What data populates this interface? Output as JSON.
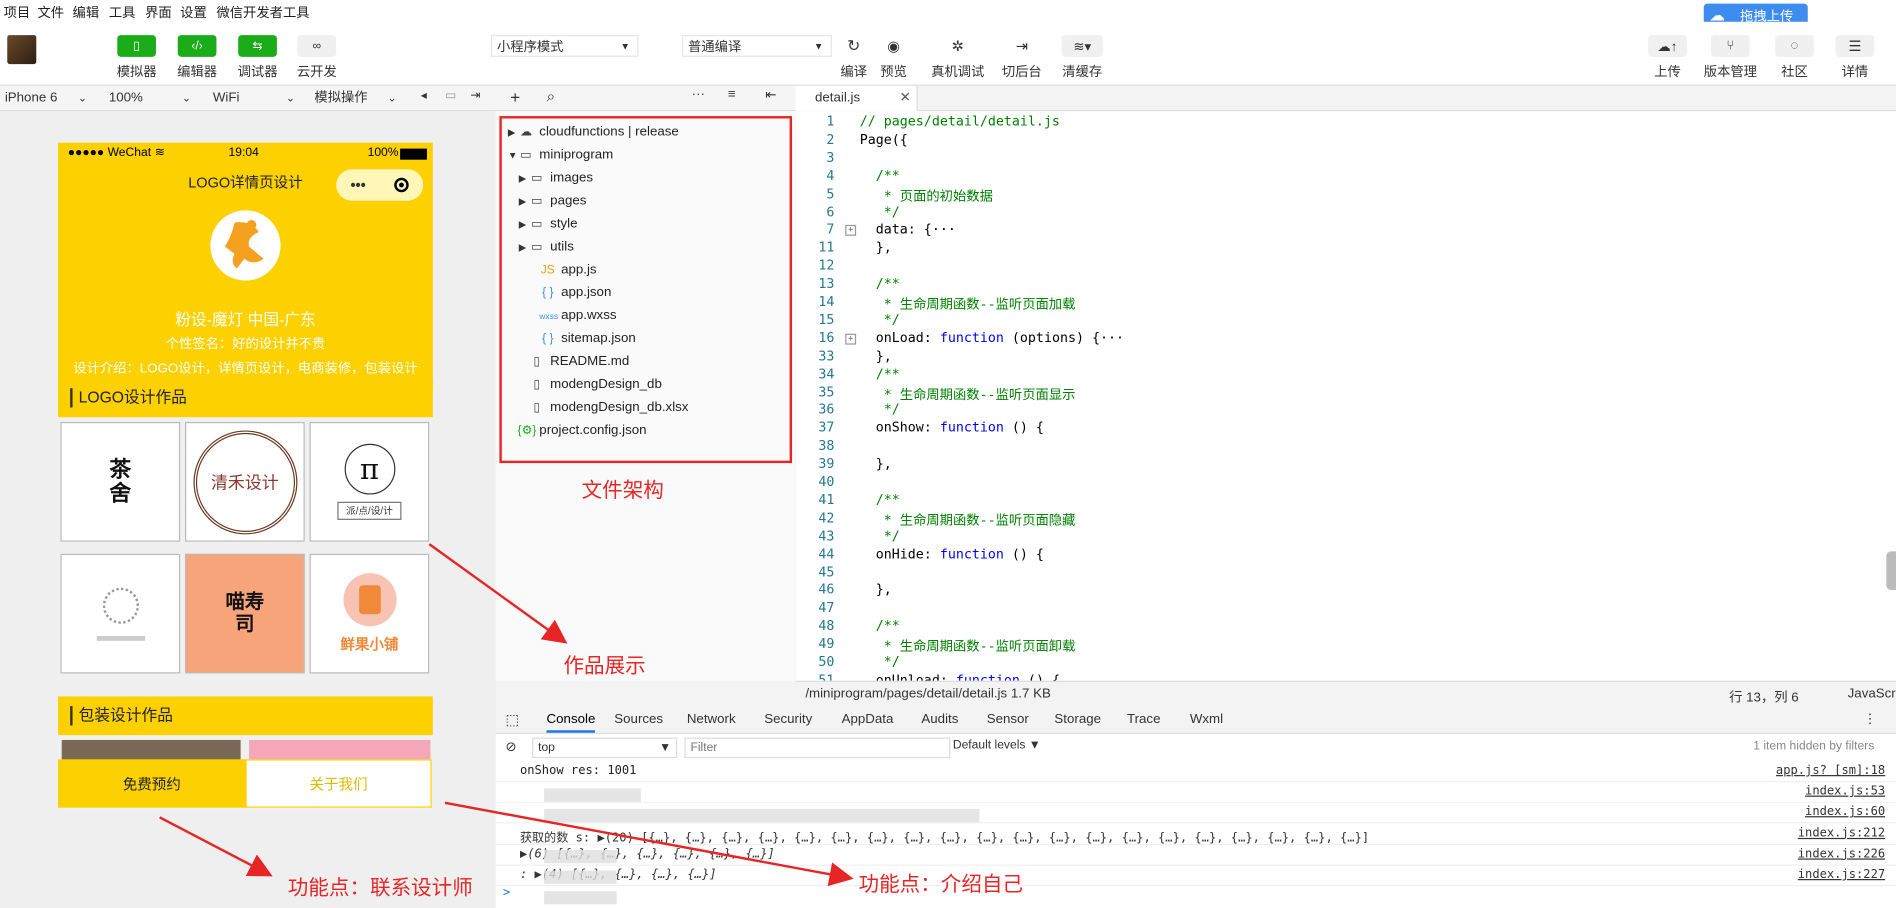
{
  "menubar": {
    "items": [
      "项目",
      "文件",
      "编辑",
      "工具",
      "界面",
      "设置",
      "微信开发者工具"
    ],
    "upload_badge": "拖拽上传"
  },
  "toolbar": {
    "left_buttons": [
      {
        "label": "模拟器",
        "icon": "phone-icon"
      },
      {
        "label": "编辑器",
        "icon": "code-icon"
      },
      {
        "label": "调试器",
        "icon": "debug-icon"
      },
      {
        "label": "云开发",
        "icon": "cloud-link-icon"
      }
    ],
    "mode_select": "小程序模式",
    "compile_select": "普通编译",
    "mid_buttons": [
      {
        "label": "编译",
        "icon": "refresh-icon"
      },
      {
        "label": "预览",
        "icon": "eye-icon"
      },
      {
        "label": "真机调试",
        "icon": "bug-icon"
      },
      {
        "label": "切后台",
        "icon": "switch-icon"
      },
      {
        "label": "清缓存",
        "icon": "layers-icon"
      }
    ],
    "right_buttons": [
      {
        "label": "上传",
        "icon": "upload-icon"
      },
      {
        "label": "版本管理",
        "icon": "branch-icon"
      },
      {
        "label": "社区",
        "icon": "chat-icon"
      },
      {
        "label": "详情",
        "icon": "menu-icon"
      }
    ]
  },
  "devicebar": {
    "device": "iPhone 6",
    "zoom": "100%",
    "network": "WiFi",
    "operation": "模拟操作"
  },
  "phone": {
    "carrier": "●●●●● WeChat",
    "time": "19:04",
    "battery": "100%",
    "nav_title": "LOGO详情页设计",
    "profile_name": "粉设-魔灯 中国-广东",
    "signature": "个性签名：好的设计并不贵",
    "intro": "设计介绍：LOGO设计，详情页设计，电商装修，包装设计",
    "section1_title": "LOGO设计作品",
    "section2_title": "包装设计作品",
    "thumbs": [
      {
        "text": "茶舍",
        "sub": "",
        "bg": "#ffffff",
        "color": "#111"
      },
      {
        "text": "清禾设计",
        "sub": "",
        "bg": "#ffffff",
        "color": "#8b3a2e"
      },
      {
        "text": "π",
        "sub": "派/点/设/计",
        "bg": "#ffffff",
        "color": "#111"
      },
      {
        "text": "",
        "sub": "",
        "bg": "#ffffff",
        "color": "#555"
      },
      {
        "text": "喵寿司",
        "sub": "",
        "bg": "#f7a47a",
        "color": "#111"
      },
      {
        "text": "鲜果小铺",
        "sub": "",
        "bg": "#ffffff",
        "color": "#f08a3a"
      }
    ],
    "btn_book": "免费预约",
    "btn_about": "关于我们"
  },
  "explorer": {
    "tree": [
      {
        "label": "cloudfunctions | release",
        "type": "cloud-folder",
        "arrow": "▶",
        "indent": 0
      },
      {
        "label": "miniprogram",
        "type": "folder",
        "arrow": "▼",
        "indent": 0
      },
      {
        "label": "images",
        "type": "folder",
        "arrow": "▶",
        "indent": 1
      },
      {
        "label": "pages",
        "type": "folder",
        "arrow": "▶",
        "indent": 1
      },
      {
        "label": "style",
        "type": "folder",
        "arrow": "▶",
        "indent": 1
      },
      {
        "label": "utils",
        "type": "folder",
        "arrow": "▶",
        "indent": 1
      },
      {
        "label": "app.js",
        "type": "js",
        "arrow": "",
        "indent": 2
      },
      {
        "label": "app.json",
        "type": "json",
        "arrow": "",
        "indent": 2
      },
      {
        "label": "app.wxss",
        "type": "wxss",
        "arrow": "",
        "indent": 2
      },
      {
        "label": "sitemap.json",
        "type": "json",
        "arrow": "",
        "indent": 2
      },
      {
        "label": "README.md",
        "type": "file",
        "arrow": "",
        "indent": 1
      },
      {
        "label": "modengDesign_db",
        "type": "file",
        "arrow": "",
        "indent": 1
      },
      {
        "label": "modengDesign_db.xlsx",
        "type": "file",
        "arrow": "",
        "indent": 1
      },
      {
        "label": "project.config.json",
        "type": "config",
        "arrow": "",
        "indent": 0
      }
    ]
  },
  "editor": {
    "tab": "detail.js",
    "lines": [
      {
        "n": "1",
        "t": "// pages/detail/detail.js",
        "c": "cm",
        "fold": false
      },
      {
        "n": "2",
        "t": "Page({",
        "c": "",
        "fold": false
      },
      {
        "n": "3",
        "t": "",
        "c": "",
        "fold": false
      },
      {
        "n": "4",
        "t": "  /**",
        "c": "cm",
        "fold": false
      },
      {
        "n": "5",
        "t": "   * 页面的初始数据",
        "c": "cm",
        "fold": false
      },
      {
        "n": "6",
        "t": "   */",
        "c": "cm",
        "fold": false
      },
      {
        "n": "7",
        "t": "  data: {···",
        "c": "",
        "fold": true
      },
      {
        "n": "11",
        "t": "  },",
        "c": "",
        "fold": false
      },
      {
        "n": "12",
        "t": "",
        "c": "",
        "fold": false
      },
      {
        "n": "13",
        "t": "  /**",
        "c": "cm",
        "fold": false
      },
      {
        "n": "14",
        "t": "   * 生命周期函数--监听页面加载",
        "c": "cm",
        "fold": false
      },
      {
        "n": "15",
        "t": "   */",
        "c": "cm",
        "fold": false
      },
      {
        "n": "16",
        "t": "  onLoad: function (options) {···",
        "c": "fn",
        "fold": true
      },
      {
        "n": "33",
        "t": "  },",
        "c": "",
        "fold": false
      },
      {
        "n": "34",
        "t": "  /**",
        "c": "cm",
        "fold": false
      },
      {
        "n": "35",
        "t": "   * 生命周期函数--监听页面显示",
        "c": "cm",
        "fold": false
      },
      {
        "n": "36",
        "t": "   */",
        "c": "cm",
        "fold": false
      },
      {
        "n": "37",
        "t": "  onShow: function () {",
        "c": "fn",
        "fold": false
      },
      {
        "n": "38",
        "t": "",
        "c": "",
        "fold": false
      },
      {
        "n": "39",
        "t": "  },",
        "c": "",
        "fold": false
      },
      {
        "n": "40",
        "t": "",
        "c": "",
        "fold": false
      },
      {
        "n": "41",
        "t": "  /**",
        "c": "cm",
        "fold": false
      },
      {
        "n": "42",
        "t": "   * 生命周期函数--监听页面隐藏",
        "c": "cm",
        "fold": false
      },
      {
        "n": "43",
        "t": "   */",
        "c": "cm",
        "fold": false
      },
      {
        "n": "44",
        "t": "  onHide: function () {",
        "c": "fn",
        "fold": false
      },
      {
        "n": "45",
        "t": "",
        "c": "",
        "fold": false
      },
      {
        "n": "46",
        "t": "  },",
        "c": "",
        "fold": false
      },
      {
        "n": "47",
        "t": "",
        "c": "",
        "fold": false
      },
      {
        "n": "48",
        "t": "  /**",
        "c": "cm",
        "fold": false
      },
      {
        "n": "49",
        "t": "   * 生命周期函数--监听页面卸载",
        "c": "cm",
        "fold": false
      },
      {
        "n": "50",
        "t": "   */",
        "c": "cm",
        "fold": false
      },
      {
        "n": "51",
        "t": "  onUnload: function () {",
        "c": "fn",
        "fold": false
      }
    ],
    "status_path": "/miniprogram/pages/detail/detail.js",
    "status_size": "1.7 KB",
    "status_pos": "行 13，列 6",
    "status_lang": "JavaScript"
  },
  "console": {
    "tabs": [
      "Console",
      "Sources",
      "Network",
      "Security",
      "AppData",
      "Audits",
      "Sensor",
      "Storage",
      "Trace",
      "Wxml"
    ],
    "context": "top",
    "filter_placeholder": "Filter",
    "levels": "Default levels",
    "hidden_note": "1 item hidden by filters",
    "logs": [
      {
        "msg": "onShow res: 1001",
        "src": "app.js? [sm]:18"
      },
      {
        "msg": "",
        "src": "index.js:53"
      },
      {
        "msg": "",
        "src": "index.js:60"
      },
      {
        "msg": "获取的数      s: ▶(20) [{…}, {…}, {…}, {…}, {…}, {…}, {…}, {…}, {…}, {…}, {…}, {…}, {…}, {…}, {…}, {…}, {…}, {…}, {…}, {…}]",
        "src": "index.js:212"
      },
      {
        "msg": "                 ▶(6) [{…}, {…}, {…}, {…}, {…}, {…}]",
        "src": "index.js:226"
      },
      {
        "msg": "                 : ▶(4) [{…}, {…}, {…}, {…}]",
        "src": "index.js:227"
      }
    ],
    "prompt": ">"
  },
  "annotations": {
    "file_structure": "文件架构",
    "works_display": "作品展示",
    "contact_designer": "功能点：联系设计师",
    "introduce_self": "功能点：介绍自己"
  },
  "colors": {
    "accent_yellow": "#fdd000",
    "annotation_red": "#e82525",
    "toolbar_green": "#1aad19"
  }
}
